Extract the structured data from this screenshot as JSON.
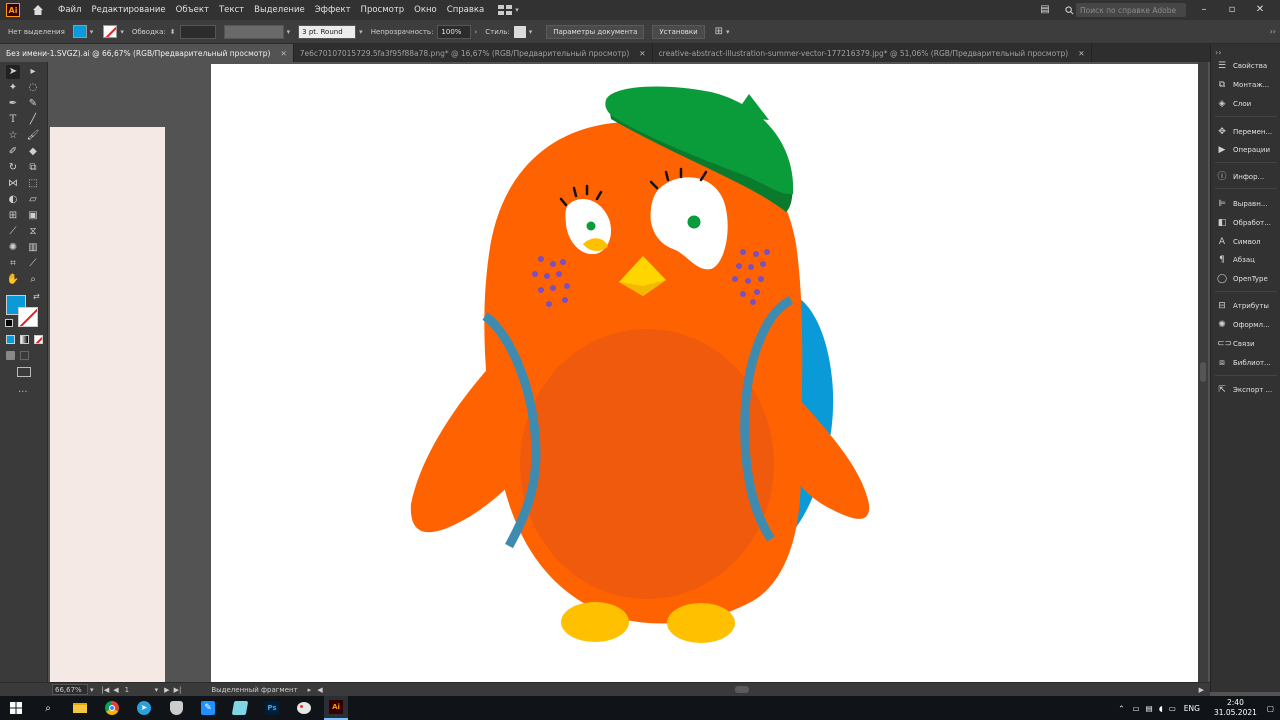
{
  "menu": {
    "items": [
      "Файл",
      "Редактирование",
      "Объект",
      "Текст",
      "Выделение",
      "Эффект",
      "Просмотр",
      "Окно",
      "Справка"
    ],
    "search_placeholder": "Поиск по справке Adobe"
  },
  "control": {
    "selection_label": "Нет выделения",
    "stroke_label": "Обводка:",
    "stroke_profile": "3 pt. Round",
    "opacity_label": "Непрозрачность:",
    "opacity_value": "100%",
    "style_label": "Стиль:",
    "doc_settings_button": "Параметры документа",
    "prefs_button": "Установки"
  },
  "tabs": [
    {
      "label": "Без имени-1.SVGZ).ai @ 66,67% (RGB/Предварительный просмотр)",
      "active": true
    },
    {
      "label": "7e6c70107015729.5fa3f95f88a78.png* @ 16,67% (RGB/Предварительный просмотр)",
      "active": false
    },
    {
      "label": "creative-abstract-illustration-summer-vector-177216379.jpg* @ 51,06% (RGB/Предварительный просмотр)",
      "active": false
    }
  ],
  "right_panel": {
    "items": [
      {
        "label": "Свойства",
        "icon": "sliders-icon"
      },
      {
        "label": "Монтаж...",
        "icon": "artboards-icon"
      },
      {
        "label": "Слои",
        "icon": "layers-icon"
      },
      {
        "label": "Перемен...",
        "icon": "transform-icon"
      },
      {
        "label": "Операции",
        "icon": "play-icon"
      },
      {
        "label": "Инфор...",
        "icon": "info-icon"
      },
      {
        "label": "Выравн...",
        "icon": "align-icon"
      },
      {
        "label": "Обработ...",
        "icon": "pathfinder-icon"
      },
      {
        "label": "Символ",
        "icon": "character-icon"
      },
      {
        "label": "Абзац",
        "icon": "paragraph-icon"
      },
      {
        "label": "OpenType",
        "icon": "opentype-icon"
      },
      {
        "label": "Атрибуты",
        "icon": "attributes-icon"
      },
      {
        "label": "Оформл...",
        "icon": "appearance-icon"
      },
      {
        "label": "Связи",
        "icon": "links-icon"
      },
      {
        "label": "Библиот...",
        "icon": "libraries-icon"
      },
      {
        "label": "Экспорт ...",
        "icon": "export-icon"
      }
    ]
  },
  "status": {
    "zoom": "66,67%",
    "artboard_number": "1",
    "selection_tool": "Выделенный фрагмент"
  },
  "taskbar": {
    "lang": "ENG",
    "time": "2:40",
    "date": "31.05.2021"
  },
  "colors": {
    "body": "#FF6200",
    "belly": "#F05A0C",
    "beret": "#0A9B3A",
    "backpack": "#0A9AD8",
    "beak": "#FFD500",
    "feet": "#FFC000",
    "freckles": "#7B4FC0"
  }
}
